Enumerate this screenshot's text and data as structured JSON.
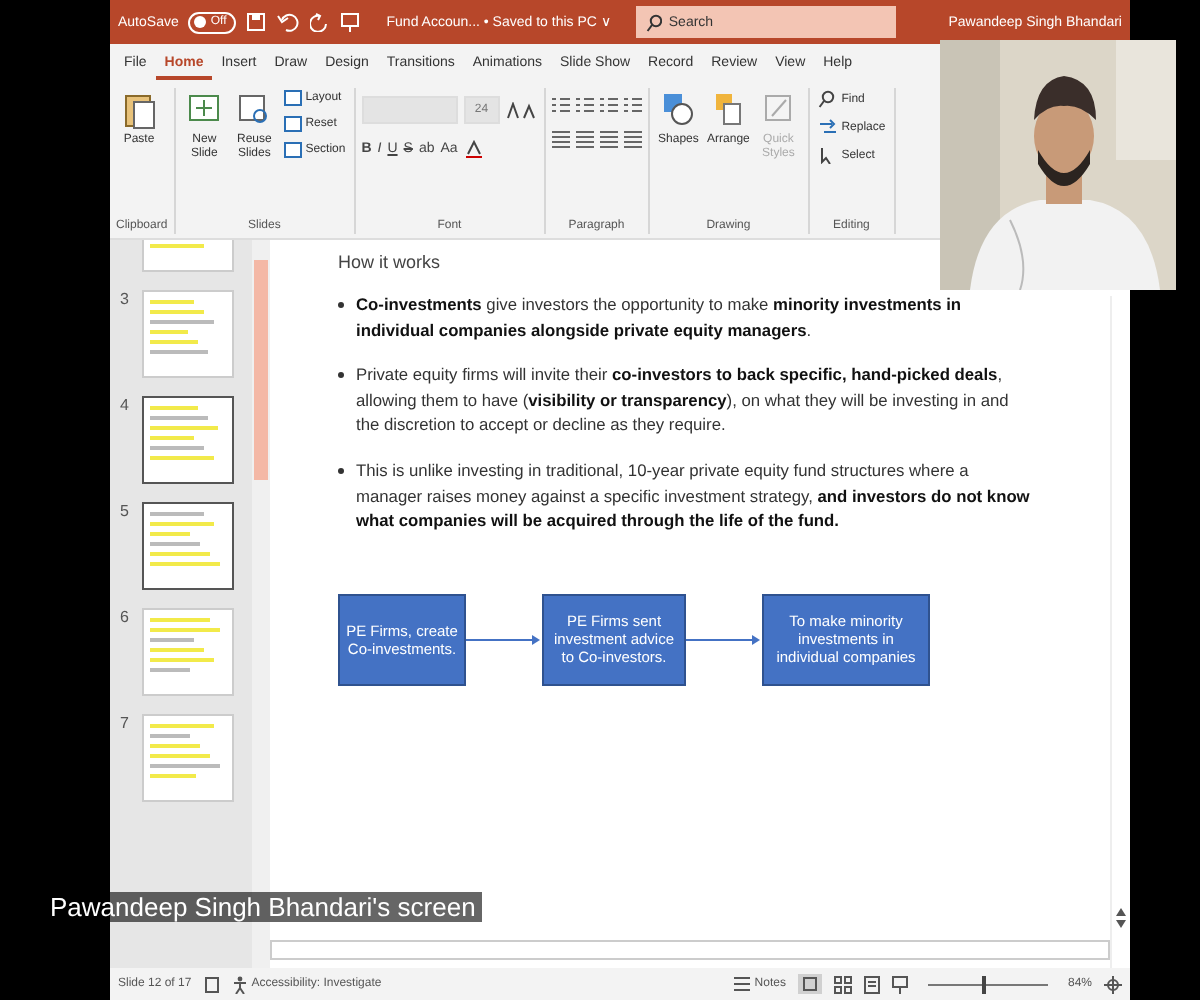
{
  "title_bar": {
    "autosave_label": "AutoSave",
    "autosave_toggle": {
      "label": "Off",
      "on": false
    },
    "document_title": "Fund Accoun... • Saved to this PC ∨",
    "search": {
      "placeholder": "Search"
    },
    "user": "Pawandeep Singh Bhandari"
  },
  "tabs": [
    {
      "label": "File",
      "selected": false
    },
    {
      "label": "Home",
      "selected": true
    },
    {
      "label": "Insert",
      "selected": false
    },
    {
      "label": "Draw",
      "selected": false
    },
    {
      "label": "Design",
      "selected": false
    },
    {
      "label": "Transitions",
      "selected": false
    },
    {
      "label": "Animations",
      "selected": false
    },
    {
      "label": "Slide Show",
      "selected": false
    },
    {
      "label": "Record",
      "selected": false
    },
    {
      "label": "Review",
      "selected": false
    },
    {
      "label": "View",
      "selected": false
    },
    {
      "label": "Help",
      "selected": false
    }
  ],
  "ribbon": {
    "groups": [
      {
        "kind": "clipboard",
        "label": "Clipboard",
        "buttons": [
          {
            "label": "Paste",
            "disabled": false
          }
        ]
      },
      {
        "kind": "slides",
        "label": "Slides",
        "buttons": [
          {
            "label": "New Slide",
            "disabled": false
          },
          {
            "label": "Reuse Slides",
            "disabled": false
          },
          {
            "label": "Layout",
            "disabled": false
          },
          {
            "label": "Reset",
            "disabled": false
          },
          {
            "label": "Section",
            "disabled": false
          }
        ]
      },
      {
        "kind": "font",
        "label": "Font",
        "font_size": "24",
        "buttons": [
          {
            "label": "B"
          },
          {
            "label": "I"
          },
          {
            "label": "U"
          },
          {
            "label": "S"
          },
          {
            "label": "ab"
          },
          {
            "label": "Aa"
          }
        ]
      },
      {
        "kind": "paragraph",
        "label": "Paragraph"
      },
      {
        "kind": "drawing",
        "label": "Drawing",
        "buttons": [
          {
            "label": "Shapes",
            "disabled": false
          },
          {
            "label": "Arrange",
            "disabled": false
          },
          {
            "label": "Quick Styles",
            "disabled": true
          }
        ]
      },
      {
        "kind": "editing",
        "label": "Editing",
        "buttons": [
          {
            "label": "Find"
          },
          {
            "label": "Replace"
          },
          {
            "label": "Select"
          }
        ]
      }
    ]
  },
  "thumbnails": [
    {
      "highlighted": false
    },
    {
      "number": "3",
      "highlighted": false
    },
    {
      "number": "4",
      "highlighted": true
    },
    {
      "number": "5",
      "highlighted": true
    },
    {
      "number": "6",
      "highlighted": false
    },
    {
      "number": "7",
      "highlighted": false
    }
  ],
  "slide": {
    "heading": "How it works",
    "bullets": [
      "**Co-investments** give investors the opportunity to make **minority investments in individual companies alongside private equity managers**.",
      "Private equity firms will invite their **co-investors to back specific, hand-picked deals**, allowing them to have (**visibility or transparency**), on what they will be investing in and the discretion to accept or decline as they require.",
      "This is unlike investing in traditional, 10-year private equity fund structures where a manager raises money against a specific investment strategy, **and investors do not know what companies will be acquired through the life of the fund.**"
    ],
    "flow": [
      "PE Firms, create Co-investments.",
      "PE Firms sent investment advice to Co-investors.",
      "To make minority investments in individual companies"
    ]
  },
  "status_bar": {
    "slide_position": "Slide 12 of 17",
    "accessibility": "Accessibility: Investigate",
    "notes": "Notes",
    "zoom": {
      "level": 0.45,
      "reading": "84%"
    }
  },
  "video_overlay": {
    "kind": "picture",
    "caption": "Pawandeep Singh Bhandari's screen"
  }
}
